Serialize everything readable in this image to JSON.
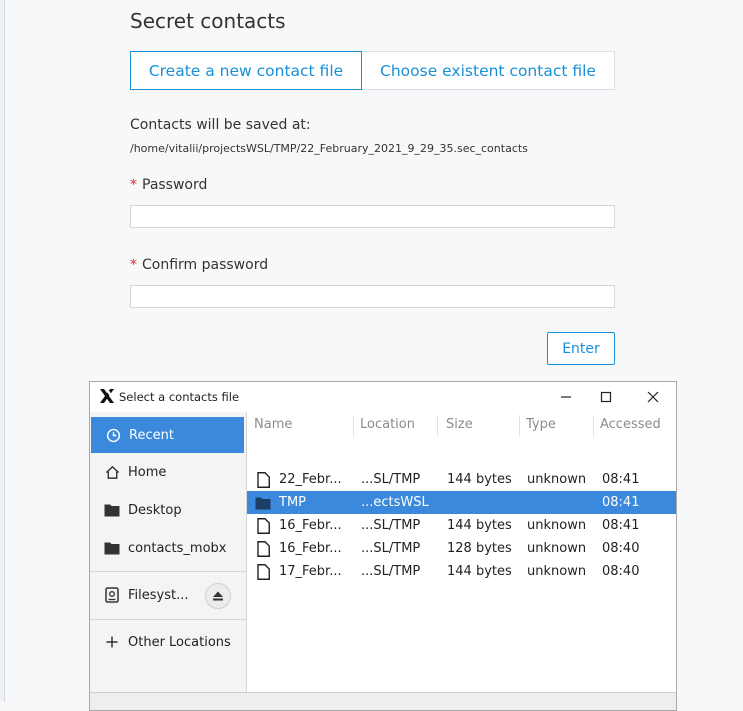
{
  "page": {
    "title": "Secret contacts",
    "tabs": [
      {
        "label": "Create a new contact file"
      },
      {
        "label": "Choose existent contact file"
      }
    ],
    "save_label": "Contacts will be saved at:",
    "save_path": "/home/vitalii/projectsWSL/TMP/22_February_2021_9_29_35.sec_contacts",
    "password_label": "Password",
    "confirm_label": "Confirm password",
    "required_mark": "*",
    "enter_label": "Enter",
    "accent_color": "#1890d8",
    "required_color": "#f5222d"
  },
  "dialog": {
    "title": "Select a contacts file",
    "window_buttons": [
      "minimize-icon",
      "maximize-icon",
      "close-icon"
    ],
    "sidebar": {
      "items": [
        {
          "label": "Recent",
          "icon": "clock-icon",
          "selected": true
        },
        {
          "label": "Home",
          "icon": "home-icon"
        },
        {
          "label": "Desktop",
          "icon": "folder-icon"
        },
        {
          "label": "contacts_mobx",
          "icon": "folder-icon"
        },
        {
          "label": "Filesyst...",
          "icon": "drive-icon"
        },
        {
          "label": "Other Locations",
          "icon": "plus-icon"
        }
      ]
    },
    "columns": [
      "Name",
      "Location",
      "Size",
      "Type",
      "Accessed"
    ],
    "files": [
      {
        "name": "22_Febr...",
        "location": "...SL/TMP",
        "size": "144 bytes",
        "type": "unknown",
        "accessed": "08:41",
        "icon": "file-icon"
      },
      {
        "name": "TMP",
        "location": "...ectsWSL",
        "size": "",
        "type": "",
        "accessed": "08:41",
        "icon": "folder-icon",
        "selected": true
      },
      {
        "name": "16_Febr...",
        "location": "...SL/TMP",
        "size": "144 bytes",
        "type": "unknown",
        "accessed": "08:41",
        "icon": "file-icon"
      },
      {
        "name": "16_Febr...",
        "location": "...SL/TMP",
        "size": "128 bytes",
        "type": "unknown",
        "accessed": "08:40",
        "icon": "file-icon"
      },
      {
        "name": "17_Febr...",
        "location": "...SL/TMP",
        "size": "144 bytes",
        "type": "unknown",
        "accessed": "08:40",
        "icon": "file-icon"
      }
    ],
    "selection_color": "#3a89dd"
  }
}
